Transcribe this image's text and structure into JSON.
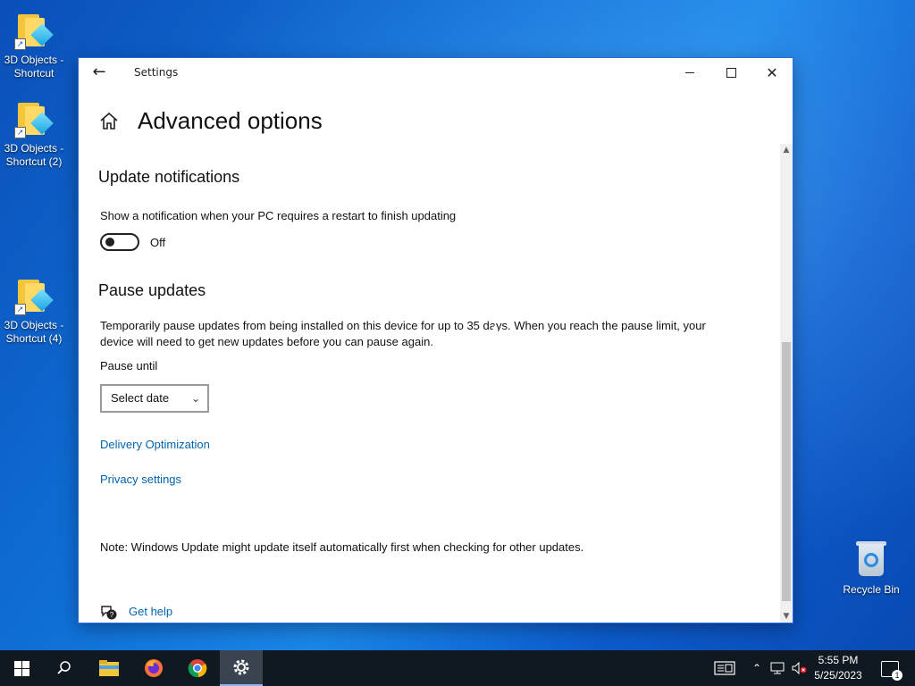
{
  "desktop": {
    "icons": [
      {
        "label": "3D Objects - Shortcut",
        "icon": "3d-objects-folder-icon"
      },
      {
        "label": "3D Objects - Shortcut (2)",
        "icon": "3d-objects-folder-icon"
      },
      {
        "label": "3D Objects - Shortcut (4)",
        "icon": "3d-objects-folder-icon"
      },
      {
        "label": "Recycle Bin",
        "icon": "recycle-bin-icon"
      }
    ]
  },
  "window": {
    "title": "Settings",
    "back_icon": "back-arrow-icon",
    "controls": {
      "minimize": "minimize",
      "maximize": "maximize",
      "close": "close"
    }
  },
  "page": {
    "title": "Advanced options",
    "update_notifications": {
      "heading": "Update notifications",
      "description": "Show a notification when your PC requires a restart to finish updating",
      "toggle_state": "Off"
    },
    "pause_updates": {
      "heading": "Pause updates",
      "description_line1": "Temporarily pause updates from being installed on this device for up to 35 days. When you reach the pause limit, your",
      "description_line2": "device will need to get new updates before you can pause again.",
      "pause_until_label": "Pause until",
      "select_value": "Select date"
    },
    "links": {
      "delivery_optimization": "Delivery Optimization",
      "privacy_settings": "Privacy settings"
    },
    "note": "Note: Windows Update might update itself automatically first when checking for other updates.",
    "get_help": "Get help"
  },
  "taskbar": {
    "apps": [
      "start",
      "search",
      "file-explorer",
      "firefox",
      "chrome",
      "settings"
    ],
    "clock_time": "5:55 PM",
    "clock_date": "5/25/2023",
    "notification_count": "1"
  },
  "colors": {
    "link": "#0063b1",
    "taskbar": "#101820",
    "desktop_accent": "#0f6fd6"
  }
}
